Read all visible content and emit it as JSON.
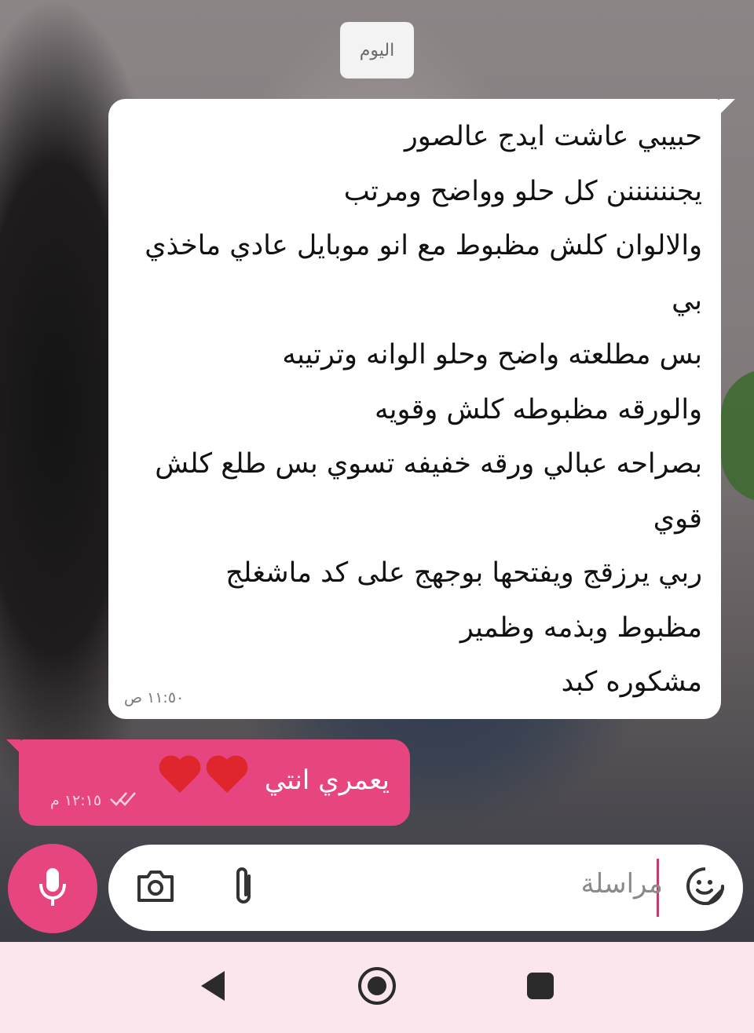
{
  "date_chip": "اليوم",
  "incoming": {
    "lines": [
      "حبيبي عاشت ايدج عالصور",
      "يجننننننن كل حلو وواضح ومرتب",
      "والالوان كلش مظبوط مع انو موبايل عادي ماخذي",
      "بي",
      "بس مطلعته واضح وحلو الوانه وترتيبه",
      "والورقه مظبوطه كلش وقويه",
      "بصراحه عبالي ورقه خفيفه تسوي بس طلع كلش",
      "قوي",
      "ربي يرزقج ويفتحها بوجهج على كد ماشغلج",
      "مظبوط وبذمه وظمير",
      "مشكوره كبد"
    ],
    "time": "١١:٥٠ ص"
  },
  "outgoing": {
    "text": "يعمري انتي",
    "time": "١٢:١٥ م",
    "status_icon": "double-check-icon"
  },
  "composer": {
    "placeholder": "مراسلة",
    "icons": [
      "sticker-icon",
      "attachment-icon",
      "camera-icon",
      "microphone-icon"
    ]
  },
  "navbar": {
    "icons": [
      "back-icon",
      "home-icon",
      "recents-icon"
    ]
  },
  "colors": {
    "accent": "#e7457f",
    "bubble_in": "#ffffff",
    "navbar_bg": "#fbe6ee"
  }
}
